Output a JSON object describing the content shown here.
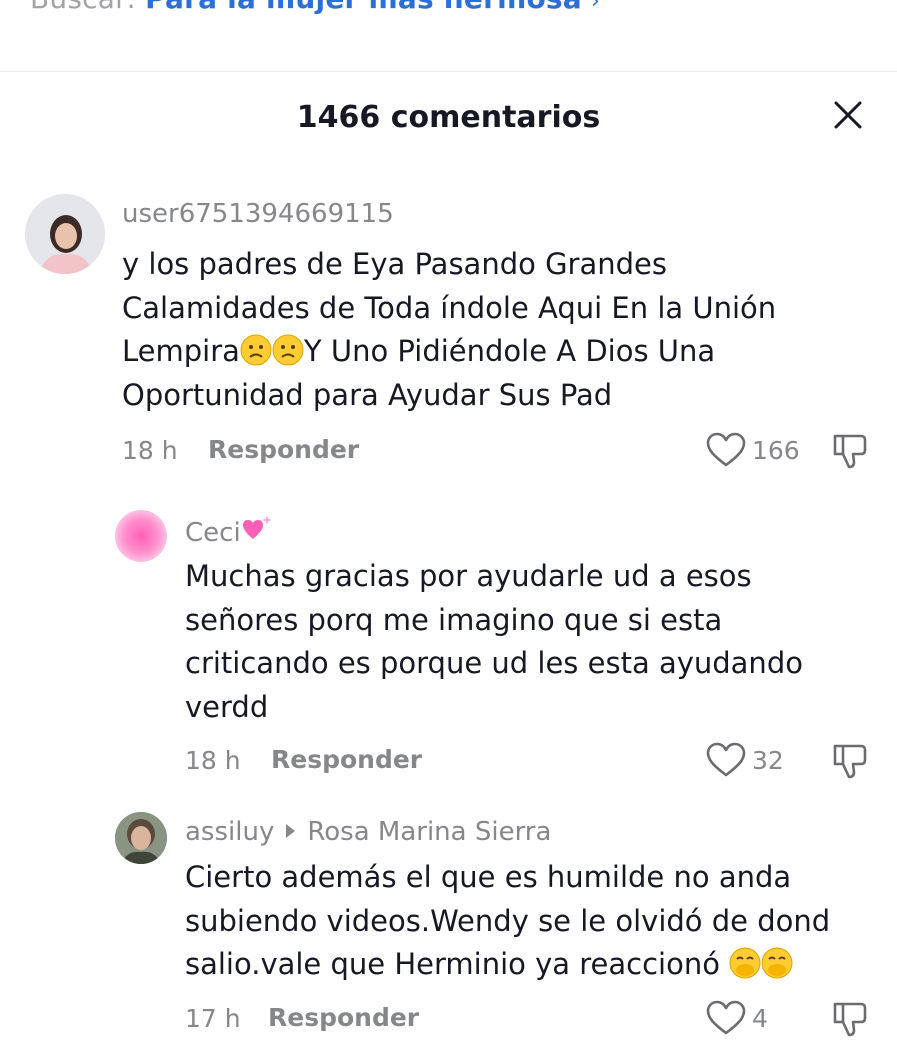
{
  "search": {
    "prefix": "Buscar:",
    "query": "Para la mujer más hermosa",
    "arrow": "›"
  },
  "header": {
    "title": "1466 comentarios",
    "close_icon": "close-icon"
  },
  "labels": {
    "reply": "Responder"
  },
  "comments": [
    {
      "username": "user6751394669115",
      "lines": [
        "y los padres de Eya Pasando Grandes",
        "Calamidades de Toda índole Aqui En la Unión",
        "Lempira",
        "Y Uno Pidiéndole A Dios Una",
        "Oportunidad para Ayudar Sus Pad"
      ],
      "emoji": "frowning-face-emoji",
      "time": "18 h",
      "likes": "166"
    },
    {
      "username": "Ceci",
      "username_emoji": "sparkling-heart-emoji",
      "lines": [
        "Muchas gracias por ayudarle ud a esos",
        "señores porq me imagino que si esta",
        "criticando es porque ud les esta ayudando",
        "verdd"
      ],
      "time": "18 h",
      "likes": "32"
    },
    {
      "username": "assiluy",
      "reply_to": "Rosa Marina Sierra",
      "lines": [
        "Cierto además el que es humilde no anda",
        "subiendo videos.Wendy se le olvidó de dond",
        "salio.vale que Herminio ya reaccionó"
      ],
      "emoji": "face-with-hand-over-mouth-emoji",
      "time": "17 h",
      "likes": "4"
    }
  ],
  "colors": {
    "accent_blue": "#2c6fd6",
    "muted": "#86878b",
    "text": "#161823",
    "pink": "#ff86c8"
  }
}
